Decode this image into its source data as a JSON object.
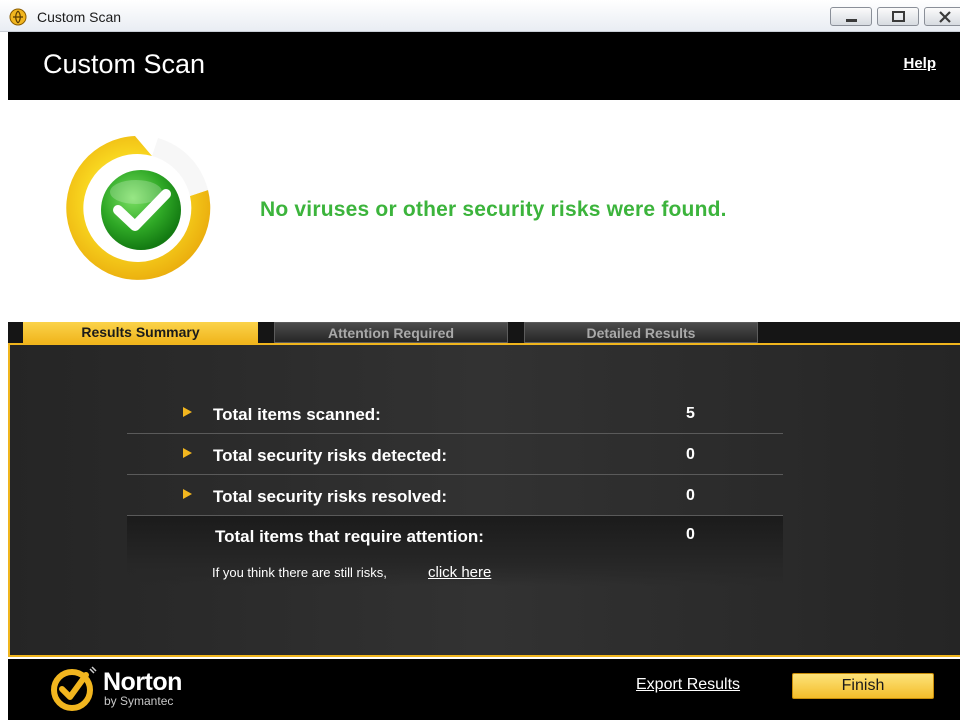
{
  "window": {
    "title": "Custom Scan",
    "controls": [
      "minimize-icon",
      "restore-icon",
      "close-icon"
    ]
  },
  "header": {
    "title": "Custom Scan",
    "help_label": "Help"
  },
  "result": {
    "message": "No viruses or other security risks were found.",
    "status_icon": "green-checkmark-icon",
    "message_color": "#3cb43c"
  },
  "tabs": [
    {
      "label": "Results Summary",
      "active": true
    },
    {
      "label": "Attention Required",
      "active": false
    },
    {
      "label": "Detailed Results",
      "active": false
    }
  ],
  "summary": {
    "rows": [
      {
        "label": "Total items scanned:",
        "value": "5"
      },
      {
        "label": "Total security risks detected:",
        "value": "0"
      },
      {
        "label": "Total security risks resolved:",
        "value": "0"
      }
    ],
    "attention": {
      "label": "Total items that require attention:",
      "value": "0"
    },
    "note": "If you think there are still risks,",
    "link": "click here"
  },
  "footer": {
    "brand": "Norton",
    "brand_sub": "by Symantec",
    "export_label": "Export Results",
    "finish_label": "Finish"
  },
  "colors": {
    "accent": "#f0b51d",
    "panel": "#2c2c2c",
    "header": "#000000"
  }
}
